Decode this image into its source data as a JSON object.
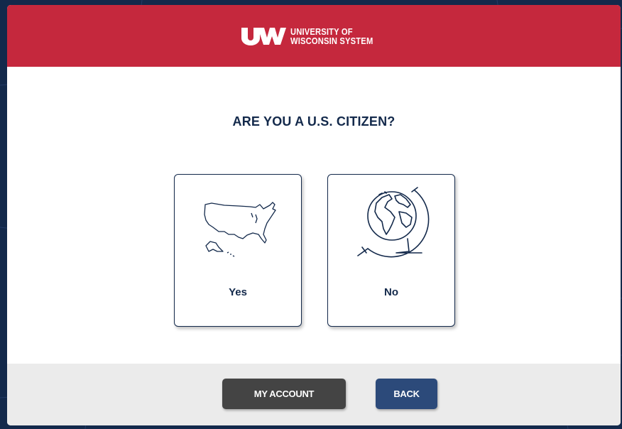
{
  "header": {
    "logo_mark": "UW",
    "logo_line1": "UNIVERSITY OF",
    "logo_line2": "WISCONSIN SYSTEM"
  },
  "question": "ARE YOU A U.S. CITIZEN?",
  "options": [
    {
      "label": "Yes",
      "icon": "usa-map-icon"
    },
    {
      "label": "No",
      "icon": "globe-icon"
    }
  ],
  "footer": {
    "my_account_label": "MY ACCOUNT",
    "back_label": "BACK"
  },
  "colors": {
    "background": "#13294b",
    "header": "#c5283d",
    "text": "#13294b",
    "account_button": "#444444",
    "back_button": "#2c4a7a",
    "footer": "#ebebeb"
  }
}
